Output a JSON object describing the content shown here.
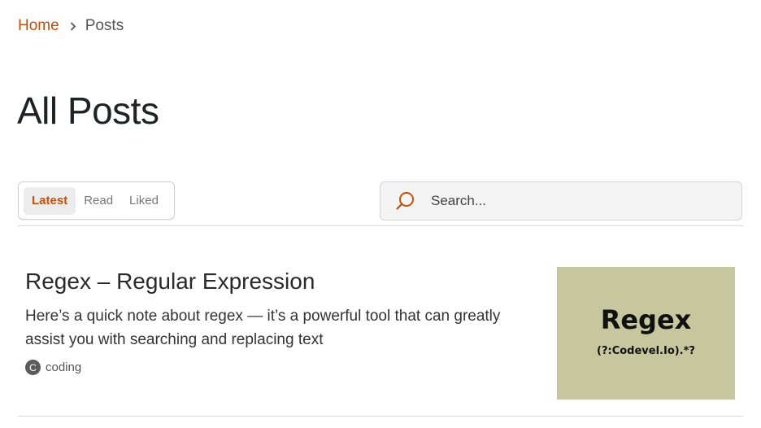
{
  "breadcrumb": {
    "home": "Home",
    "current": "Posts"
  },
  "page_title": "All Posts",
  "tabs": [
    {
      "label": "Latest",
      "active": true
    },
    {
      "label": "Read",
      "active": false
    },
    {
      "label": "Liked",
      "active": false
    }
  ],
  "search": {
    "placeholder": "Search...",
    "value": ""
  },
  "posts": [
    {
      "title": "Regex – Regular Expression",
      "excerpt": "Here’s a quick note about regex — it’s a powerful tool that can greatly assist you with searching and replacing text",
      "tag": {
        "initial": "C",
        "label": "coding"
      },
      "thumbnail": {
        "title": "Regex",
        "subtitle": "(?:Codevel.Io).*?"
      }
    }
  ],
  "icons": {
    "breadcrumb_separator": "chevron-right-icon",
    "search": "search-icon"
  },
  "colors": {
    "accent": "#c0510f",
    "thumbnail_bg": "#c6c79e",
    "active_tab_bg": "#ececec",
    "search_bg": "#f3f3f3"
  }
}
